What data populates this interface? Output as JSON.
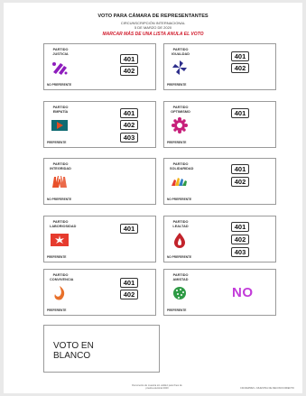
{
  "header": {
    "title": "VOTO PARA CÁMARA DE REPRESENTANTES",
    "circunscription": "CIRCUNSCRIPCIÓN INTERNACIONAL",
    "date": "5 DE MARZO DE 2020",
    "warning": "MARCAR MÁS DE UNA LISTA ANULA EL VOTO"
  },
  "parties": [
    {
      "label1": "PARTIDO",
      "label2": "JUSTICIA",
      "list_boxes": [
        "401",
        "402"
      ],
      "preference": "NO PREFERENTE",
      "logo_icon": "justice-slash-icon",
      "colors": [
        "#8e1dbd"
      ]
    },
    {
      "label1": "PARTIDO",
      "label2": "IGUALDAD",
      "list_boxes": [
        "401",
        "402"
      ],
      "preference": "PREFERENTE",
      "logo_icon": "pinwheel-icon",
      "colors": [
        "#2e2f8c"
      ]
    },
    {
      "label1": "PARTIDO",
      "label2": "EMPATÍA",
      "list_boxes": [
        "401",
        "402",
        "403"
      ],
      "preference": "PREFERENTE",
      "logo_icon": "play-flag-icon",
      "colors": [
        "#0f6b72",
        "#e24a1f"
      ]
    },
    {
      "label1": "PARTIDO",
      "label2": "OPTIMISMO",
      "list_boxes": [
        "401"
      ],
      "preference": "PREFERENTE",
      "logo_icon": "gear-flower-icon",
      "colors": [
        "#c71f7a"
      ]
    },
    {
      "label1": "PARTIDO",
      "label2": "INTEGRIDAD",
      "list_boxes": [],
      "preference": "NO PREFERENTE",
      "logo_icon": "hands-icon",
      "colors": [
        "#e8502a"
      ]
    },
    {
      "label1": "PARTIDO",
      "label2": "SOLIDARIDAD",
      "list_boxes": [
        "401",
        "402"
      ],
      "preference": "NO PREFERENTE",
      "logo_icon": "colored-hands-icon",
      "colors": [
        "#e63b2e",
        "#f2b51c",
        "#2f7dc2"
      ]
    },
    {
      "label1": "PARTIDO",
      "label2": "LABORIOSIDAD",
      "list_boxes": [
        "401"
      ],
      "preference": "PREFERENTE",
      "logo_icon": "star-burst-icon",
      "colors": [
        "#e63b2e"
      ]
    },
    {
      "label1": "PARTIDO",
      "label2": "LEALTAD",
      "list_boxes": [
        "401",
        "402",
        "403"
      ],
      "preference": "NO PREFERENTE",
      "logo_icon": "flame-drop-icon",
      "colors": [
        "#c2232b"
      ]
    },
    {
      "label1": "PARTIDO",
      "label2": "CONVIVENCIA",
      "list_boxes": [
        "401",
        "402"
      ],
      "preference": "PREFERENTE",
      "logo_icon": "swirl-flame-icon",
      "colors": [
        "#e8702a"
      ]
    },
    {
      "label1": "PARTIDO",
      "label2": "AMISTAD",
      "list_boxes": [],
      "preference": "PREFERENTE",
      "logo_icon": "globe-dots-icon",
      "colors": [
        "#2e9b45"
      ],
      "mark": "NO"
    }
  ],
  "blank_vote": {
    "text": "VOTO EN BLANCO"
  },
  "footer": {
    "center_line1": "Documento de muestra sin validez para fines de",
    "center_line2": "prueba electoral 2020",
    "right": "CIR-REPRES • MUESTRA DE RECONOCIMIENTO"
  },
  "colors": {
    "warning": "#d01a2b",
    "mark": "#c23bd9",
    "border": "#9a9a9a"
  }
}
